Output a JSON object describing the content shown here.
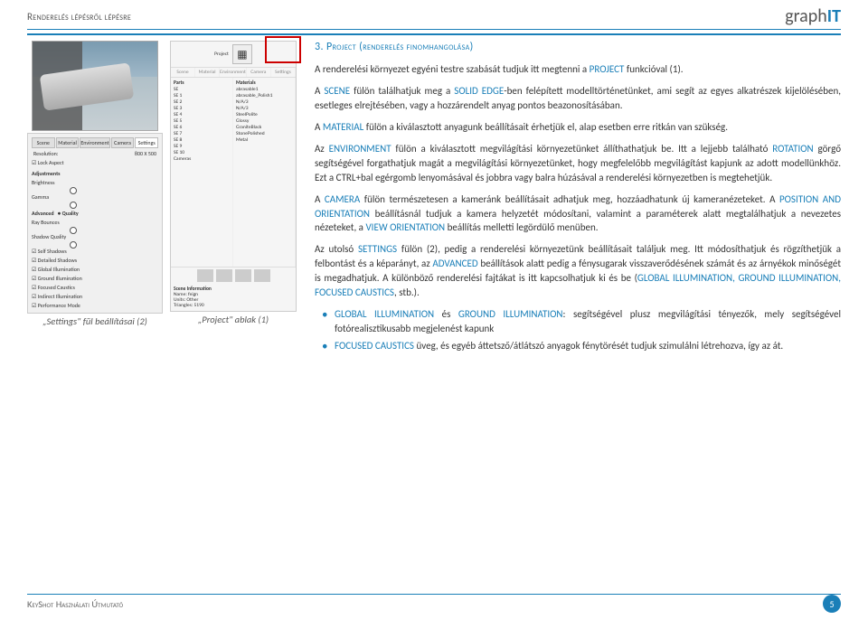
{
  "header": {
    "title": "Renderelés lépésről lépésre",
    "logo_graph": "graph",
    "logo_it": "IT"
  },
  "section_heading": "3. Project (renderelés finomhangolása)",
  "figures": {
    "settings_caption": "„Settings\" fül beállításai (2)",
    "project_caption": "„Project\" ablak (1)"
  },
  "mock_settings": {
    "tabs": [
      "Scene",
      "Material",
      "Environment",
      "Camera",
      "Settings"
    ],
    "resolution_label": "Resolution:",
    "resolution_w": "800",
    "resolution_x": "X",
    "resolution_h": "500",
    "lock_aspect": "Lock Aspect",
    "adjustments": "Adjustments",
    "brightness": "Brightness",
    "gamma": "Gamma",
    "advanced": "Advanced",
    "ray_bounces": "Ray Bounces",
    "shadow_quality": "Shadow Quality",
    "soft_illumination": "Self Shadows",
    "global_illumination": "Global Illumination",
    "ground_illumination": "Ground Illumination",
    "focused_caustics": "Focused Caustics",
    "detailed_shadows": "Detailed Shadows",
    "indirect_illumination": "Indirect Illumination",
    "performance_mode": "Performance Mode",
    "quality_label": "Quality"
  },
  "mock_project": {
    "header": "Project",
    "toolbar": [
      "Scene",
      "Material",
      "Environment",
      "Camera",
      "Settings"
    ],
    "parts_label": "Parts",
    "materials_label": "Materials",
    "parts": [
      "SE",
      "SE 1",
      "SE 2",
      "SE 3",
      "SE 4",
      "SE 5",
      "SE 6",
      "SE 7",
      "SE 8",
      "SE 9",
      "SE 10",
      "Cameras"
    ],
    "materials": [
      "abrasable1",
      "abrasable_Polish1",
      "N/A/3",
      "N/A/3",
      "SteelPolite",
      "Glossy",
      "GraniteBlack",
      "StonePolished",
      "Metal"
    ],
    "scene_info_label": "Scene Information",
    "name_label": "Name:",
    "name_value": "feign",
    "units_label": "Units:",
    "units_value": "Other",
    "triangles_label": "Triangles:",
    "triangles_value": "5190"
  },
  "paragraphs": {
    "p1_pre": "A renderelési környezet egyéni testre szabását tudjuk itt megtenni a ",
    "p1_kw": "PROJECT",
    "p1_post": " funkcióval (1).",
    "p2_pre": "A ",
    "p2_kw1": "SCENE",
    "p2_mid1": " fülön találhatjuk meg a ",
    "p2_kw2": "SOLID EDGE",
    "p2_post": "-ben felépített modelltörténetünket, ami segít az egyes alkatrészek kijelölésében, esetleges elrejtésében, vagy a hozzárendelt anyag pontos beazonosításában.",
    "p3_pre": "A ",
    "p3_kw": "MATERIAL",
    "p3_post": " fülön a kiválasztott anyagunk beállításait érhetjük el, alap esetben erre ritkán van szükség.",
    "p4_pre": "Az ",
    "p4_kw1": "ENVIRONMENT",
    "p4_mid1": " fülön a kiválasztott megvilágítási környezetünket állíthathatjuk be. Itt a lejjebb található ",
    "p4_kw2": "ROTATION",
    "p4_post": " görgő segítségével forgathatjuk magát a megvilágítási környezetünket, hogy megfelelőbb megvilágítást kapjunk az adott modellünkhöz. Ezt a CTRL+bal egérgomb lenyomásával és jobbra vagy balra húzásával a renderelési környezetben is megtehetjük.",
    "p5_pre": "A ",
    "p5_kw1": "CAMERA",
    "p5_mid1": " fülön természetesen a kameránk beállításait adhatjuk meg, hozzáadhatunk új kameranézeteket. A ",
    "p5_kw2": "POSITION AND ORIENTATION",
    "p5_mid2": " beállításnál tudjuk a kamera helyzetét módosítani, valamint a paraméterek alatt megtalálhatjuk a nevezetes nézeteket, a ",
    "p5_kw3": "VIEW ORIENTATION",
    "p5_post": " beállítás melletti legördülő menüben.",
    "p6_pre": "Az utolsó ",
    "p6_kw1": "SETTINGS",
    "p6_mid1": " fülön (2), pedig a renderelési környezetünk beállításait találjuk meg. Itt módosíthatjuk és rögzíthetjük a felbontást és a képarányt, az ",
    "p6_kw2": "ADVANCED",
    "p6_mid2": " beállítások alatt pedig a fénysugarak visszaverődésének számát és az árnyékok minőségét is megadhatjuk. A különböző renderelési fajtákat is itt kapcsolhatjuk ki és be (",
    "p6_kw3": "GLOBAL ILLUMINATION, GROUND ILLUMINATION, FOCUSED CAUSTICS",
    "p6_post": ", stb.)."
  },
  "bullets": {
    "b1_kw1": "GLOBAL ILLUMINATION",
    "b1_mid": " és ",
    "b1_kw2": "GROUND ILLUMINATION",
    "b1_post": ": segítségével plusz megvilágítási tényezők, mely segítségével fotórealisztikusabb megjelenést kapunk",
    "b2_kw": "FOCUSED CAUSTICS",
    "b2_post": " üveg, és egyéb áttetsző/átlátszó anyagok fénytörését tudjuk szimulálni létrehozva, így az át."
  },
  "footer": {
    "text": "KeyShot Használati Útmutató",
    "page": "5"
  }
}
